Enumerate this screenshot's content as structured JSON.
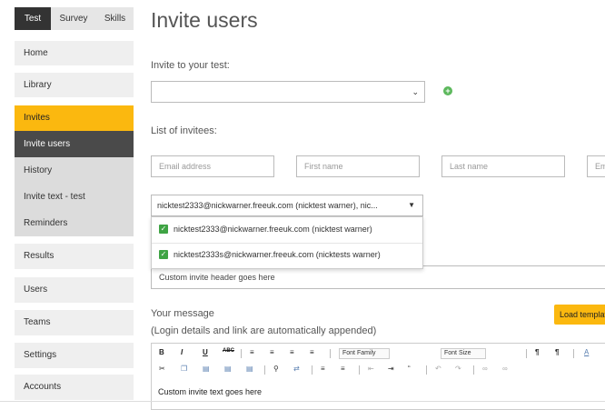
{
  "sidebar": {
    "tabs": [
      {
        "label": "Test"
      },
      {
        "label": "Survey"
      },
      {
        "label": "Skills"
      }
    ],
    "items": [
      {
        "label": "Home"
      },
      {
        "label": "Library"
      },
      {
        "label": "Invites"
      },
      {
        "label": "Invite users"
      },
      {
        "label": "History"
      },
      {
        "label": "Invite text - test"
      },
      {
        "label": "Reminders"
      },
      {
        "label": "Results"
      },
      {
        "label": "Users"
      },
      {
        "label": "Teams"
      },
      {
        "label": "Settings"
      },
      {
        "label": "Accounts"
      }
    ]
  },
  "main": {
    "title": "Invite users",
    "invite_label": "Invite to your test:",
    "test_select_value": "",
    "invitees_label": "List of invitees:",
    "fields": {
      "email_placeholder": "Email address",
      "first_placeholder": "First name",
      "last_placeholder": "Last name",
      "extra_placeholder": "Em"
    },
    "multi_select_value": "nicktest2333@nickwarner.freeuk.com (nicktest warner), nic...",
    "dropdown_items": [
      {
        "label": "nicktest2333@nickwarner.freeuk.com (nicktest warner)"
      },
      {
        "label": "nicktest2333s@nickwarner.freeuk.com (nicktests warner)"
      }
    ],
    "header_value": "Custom invite header goes here",
    "message_title": "Your message",
    "message_sub": "(Login details and link are automatically appended)",
    "load_template_label": "Load template",
    "editor": {
      "font_family": "Font Family",
      "font_size": "Font Size",
      "body_text": "Custom invite text goes here"
    }
  },
  "colors": {
    "accent": "#fbb80f",
    "dark_nav": "#4a4a4a",
    "check_green": "#3fa444"
  }
}
